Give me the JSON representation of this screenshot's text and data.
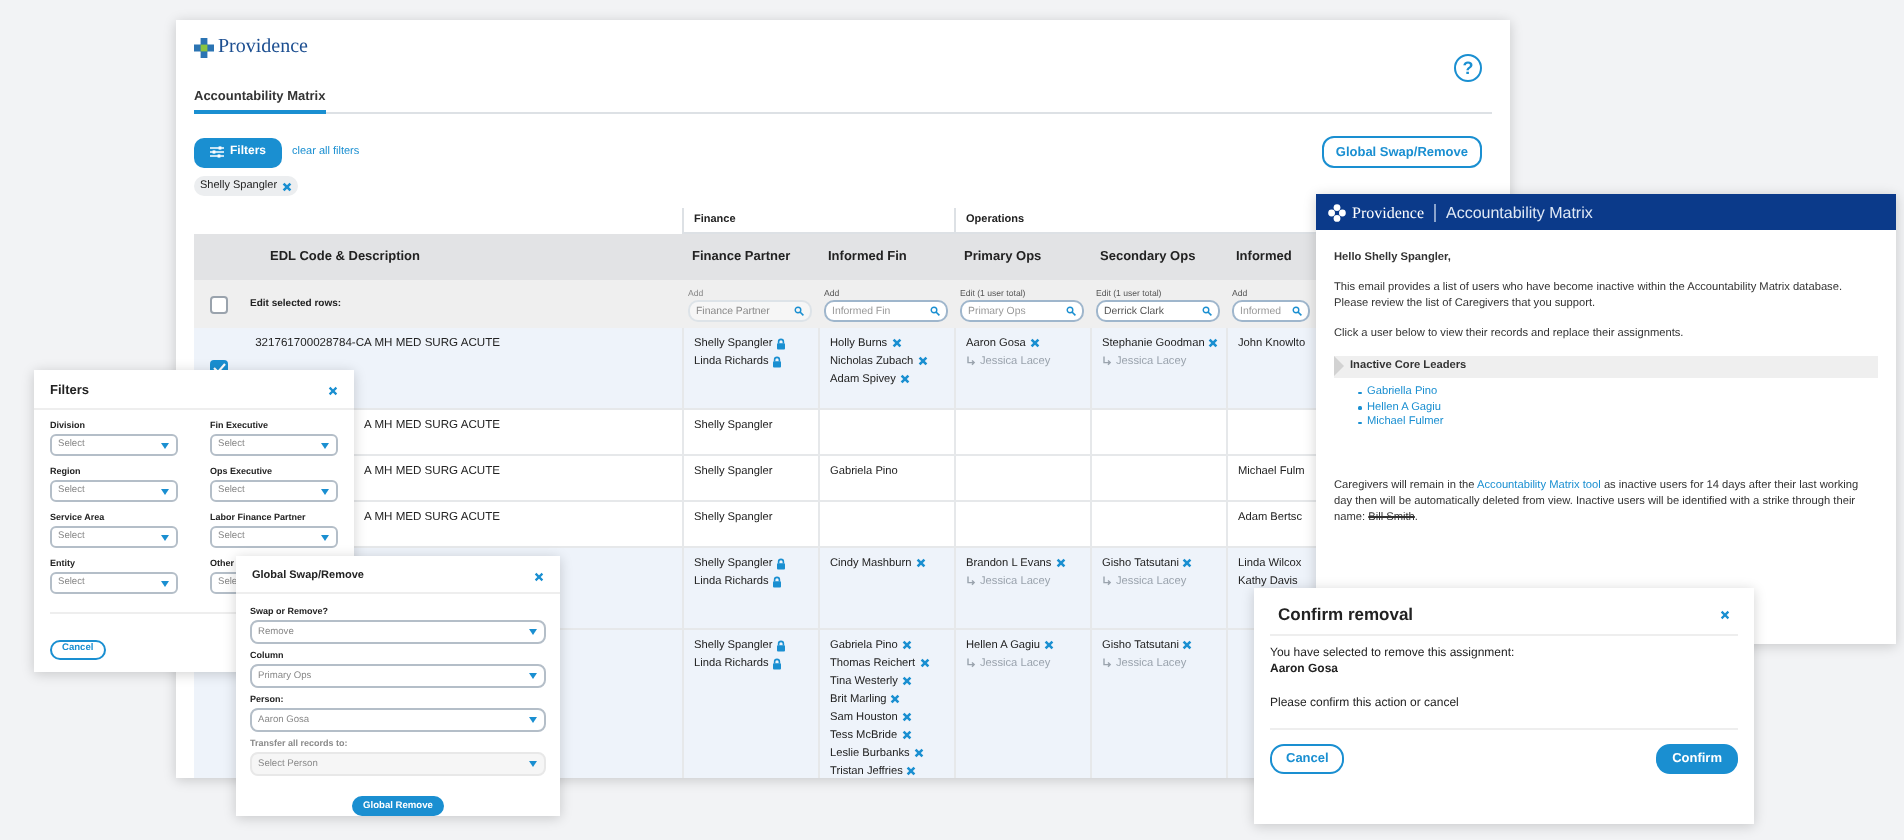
{
  "main_window": {
    "logo": "Providence",
    "help_button": "?",
    "tabs": [
      {
        "label": "Accountability Matrix",
        "selected": true
      }
    ],
    "filters_button": "Filters",
    "clear_filters_link": "clear all filters",
    "global_button": "Global Swap/Remove",
    "chips": [
      "Shelly Spangler"
    ],
    "table": {
      "first_column": "EDL Code & Description",
      "column_groups": [
        {
          "label": "Finance",
          "columns": [
            "Finance Partner",
            "Informed Fin"
          ]
        },
        {
          "label": "Operations",
          "columns": [
            "Primary Ops",
            "Secondary Ops",
            "Informed"
          ]
        }
      ],
      "edit_row": {
        "label": "Edit selected rows:",
        "checked": false,
        "fields": [
          {
            "label": "Add",
            "placeholder": "Finance Partner",
            "disabled": true
          },
          {
            "label": "Add",
            "placeholder": "Informed Fin",
            "disabled": false
          },
          {
            "label": "Edit (1 user total)",
            "placeholder": "Primary Ops",
            "disabled": false
          },
          {
            "label": "Edit (1 user total)",
            "value": "Derrick Clark",
            "disabled": false
          },
          {
            "label": "Add",
            "placeholder": "Informed",
            "disabled": false
          }
        ]
      },
      "rows": [
        {
          "selected": true,
          "checked": true,
          "edl": "321761700028784-CA MH MED SURG ACUTE",
          "cells": [
            [
              {
                "name": "Shelly Spangler",
                "kind": "locked"
              },
              {
                "name": "Linda Richards",
                "kind": "locked"
              }
            ],
            [
              {
                "name": "Holly Burns",
                "kind": "removable"
              },
              {
                "name": "Nicholas Zubach",
                "kind": "removable"
              },
              {
                "name": "Adam Spivey",
                "kind": "removable"
              }
            ],
            [
              {
                "name": "Aaron Gosa",
                "kind": "removable"
              },
              {
                "name": "Jessica Lacey",
                "kind": "delegate"
              }
            ],
            [
              {
                "name": "Stephanie Goodman",
                "kind": "removable"
              },
              {
                "name": "Jessica Lacey",
                "kind": "delegate"
              }
            ],
            [
              {
                "name": "John Knowlto",
                "kind": "plain"
              }
            ]
          ]
        },
        {
          "selected": false,
          "edl": "A MH MED SURG ACUTE",
          "cells": [
            [
              {
                "name": "Shelly Spangler",
                "kind": "plain"
              }
            ],
            [],
            [],
            [],
            []
          ]
        },
        {
          "selected": false,
          "edl": "A MH MED SURG ACUTE",
          "cells": [
            [
              {
                "name": "Shelly Spangler",
                "kind": "plain"
              }
            ],
            [
              {
                "name": "Gabriela Pino",
                "kind": "plain"
              }
            ],
            [],
            [],
            [
              {
                "name": "Michael Fulm",
                "kind": "plain"
              }
            ]
          ]
        },
        {
          "selected": false,
          "edl": "A MH MED SURG ACUTE",
          "cells": [
            [
              {
                "name": "Shelly Spangler",
                "kind": "plain"
              }
            ],
            [],
            [],
            [],
            [
              {
                "name": "Adam Bertsc",
                "kind": "plain"
              }
            ]
          ]
        },
        {
          "selected": true,
          "cells": [
            [
              {
                "name": "Shelly Spangler",
                "kind": "locked"
              },
              {
                "name": "Linda Richards",
                "kind": "locked"
              }
            ],
            [
              {
                "name": "Cindy Mashburn",
                "kind": "removable"
              }
            ],
            [
              {
                "name": "Brandon L Evans",
                "kind": "removable"
              },
              {
                "name": "Jessica Lacey",
                "kind": "delegate"
              }
            ],
            [
              {
                "name": "Gisho Tatsutani",
                "kind": "removable"
              },
              {
                "name": "Jessica Lacey",
                "kind": "delegate"
              }
            ],
            [
              {
                "name": "Linda Wilcox",
                "kind": "plain"
              },
              {
                "name": "Kathy Davis",
                "kind": "plain"
              }
            ]
          ]
        },
        {
          "selected": true,
          "cells": [
            [
              {
                "name": "Shelly Spangler",
                "kind": "locked"
              },
              {
                "name": "Linda Richards",
                "kind": "locked"
              }
            ],
            [
              {
                "name": "Gabriela Pino",
                "kind": "removable"
              },
              {
                "name": "Thomas Reichert",
                "kind": "removable"
              },
              {
                "name": "Tina Westerly",
                "kind": "removable"
              },
              {
                "name": "Brit Marling",
                "kind": "removable"
              },
              {
                "name": "Sam Houston",
                "kind": "removable"
              },
              {
                "name": "Tess McBride",
                "kind": "removable"
              },
              {
                "name": "Leslie Burbanks",
                "kind": "removable"
              },
              {
                "name": "Tristan Jeffries",
                "kind": "removable"
              }
            ],
            [
              {
                "name": "Hellen A Gagiu",
                "kind": "removable"
              },
              {
                "name": "Jessica Lacey",
                "kind": "delegate"
              }
            ],
            [
              {
                "name": "Gisho Tatsutani",
                "kind": "removable"
              },
              {
                "name": "Jessica Lacey",
                "kind": "delegate"
              }
            ],
            []
          ]
        }
      ]
    }
  },
  "email": {
    "brand": "Providence",
    "title": "Accountability Matrix",
    "greeting": "Hello Shelly Spangler,",
    "paragraphs": [
      "This email provides a list of users who have become inactive within the Accountability Matrix database. Please review the list of Caregivers that you support.",
      "Click a user below to view their records and replace their assignments."
    ],
    "section": "Inactive Core Leaders",
    "users": [
      "Gabriella Pino",
      "Hellen A Gagiu",
      "Michael Fulmer"
    ],
    "footer": [
      {
        "kind": "text",
        "text": "Caregivers will remain in the "
      },
      {
        "kind": "link",
        "text": "Accountability Matrix tool"
      },
      {
        "kind": "text",
        "text": " as inactive users for 14 days after their last working day then will be automatically deleted from view. Inactive users will be identified with a strike through their name: "
      },
      {
        "kind": "strike",
        "text": "Bill Smith"
      },
      {
        "kind": "text",
        "text": "."
      }
    ]
  },
  "filters_panel": {
    "title": "Filters",
    "fields": [
      {
        "label": "Division",
        "placeholder": "Select"
      },
      {
        "label": "Fin Executive",
        "placeholder": "Select"
      },
      {
        "label": "Region",
        "placeholder": "Select"
      },
      {
        "label": "Ops Executive",
        "placeholder": "Select"
      },
      {
        "label": "Service Area",
        "placeholder": "Select"
      },
      {
        "label": "Labor Finance Partner",
        "placeholder": "Select"
      },
      {
        "label": "Entity",
        "placeholder": "Select"
      },
      {
        "label": "Other",
        "placeholder": "Sele"
      }
    ],
    "cancel": "Cancel"
  },
  "swap_dialog": {
    "title": "Global Swap/Remove",
    "fields": [
      {
        "label": "Swap or Remove?",
        "value": "Remove",
        "disabled": false
      },
      {
        "label": "Column",
        "value": "Primary Ops",
        "disabled": false
      },
      {
        "label": "Person:",
        "value": "Aaron Gosa",
        "disabled": false
      },
      {
        "label": "Transfer all records to:",
        "value": "Select Person",
        "disabled": true
      }
    ],
    "button": "Global Remove"
  },
  "confirm_dialog": {
    "title": "Confirm removal",
    "message": "You have selected to remove this assignment:",
    "person": "Aaron Gosa",
    "question": "Please confirm this action or cancel",
    "cancel": "Cancel",
    "confirm": "Confirm"
  }
}
